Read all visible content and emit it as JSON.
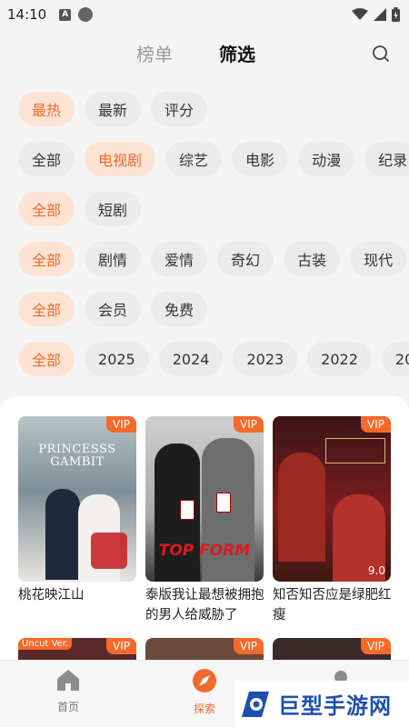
{
  "status_bar": {
    "time": "14:10"
  },
  "top_tabs": {
    "rank": "榜单",
    "filter": "筛选"
  },
  "filters": {
    "sort": [
      "最热",
      "最新",
      "评分"
    ],
    "category": [
      "全部",
      "电视剧",
      "综艺",
      "电影",
      "动漫",
      "纪录"
    ],
    "length": [
      "全部",
      "短剧"
    ],
    "genre": [
      "全部",
      "剧情",
      "爱情",
      "奇幻",
      "古装",
      "现代"
    ],
    "pay": [
      "全部",
      "会员",
      "免费"
    ],
    "year": [
      "全部",
      "2025",
      "2024",
      "2023",
      "2022",
      "20"
    ]
  },
  "cards": [
    {
      "title": "桃花映江山",
      "badge": "VIP",
      "poster_text": "PRINCESSS GAMBIT"
    },
    {
      "title": "泰版我让最想被拥抱的男人给威胁了",
      "badge": "VIP",
      "poster_text": "TOP FORM"
    },
    {
      "title": "知否知否应是绿肥红瘦",
      "badge": "VIP",
      "rating": "9.0"
    }
  ],
  "cards_row2": [
    {
      "badge": "VIP",
      "tag": "Uncut Ver."
    },
    {
      "badge": "VIP"
    },
    {
      "badge": "VIP"
    }
  ],
  "bottom_nav": {
    "home": "首页",
    "explore": "探索"
  },
  "watermark": {
    "text": "巨型手游网"
  },
  "colors": {
    "accent": "#f06a2c",
    "chip_selected_bg": "#fde3d3",
    "chip_bg": "#ebebeb",
    "vip": "#f56a2a"
  }
}
